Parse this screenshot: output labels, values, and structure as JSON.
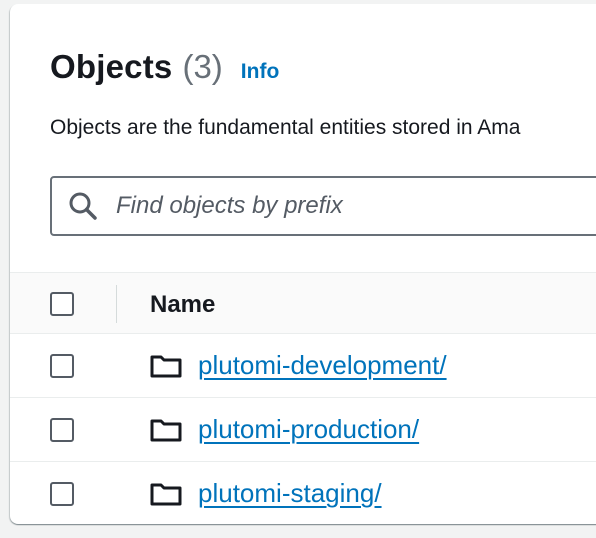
{
  "objects": {
    "title": "Objects",
    "count": "(3)",
    "info_label": "Info",
    "description": "Objects are the fundamental entities stored in Ama",
    "search": {
      "placeholder": "Find objects by prefix",
      "icon": "search-icon"
    },
    "table": {
      "columns": [
        "Name"
      ],
      "rows": [
        {
          "name": "plutomi-development/",
          "icon": "folder-icon"
        },
        {
          "name": "plutomi-production/",
          "icon": "folder-icon"
        },
        {
          "name": "plutomi-staging/",
          "icon": "folder-icon"
        }
      ]
    }
  },
  "colors": {
    "link": "#0073bb",
    "text": "#16191f",
    "muted": "#687078",
    "background": "#f2f3f3"
  }
}
